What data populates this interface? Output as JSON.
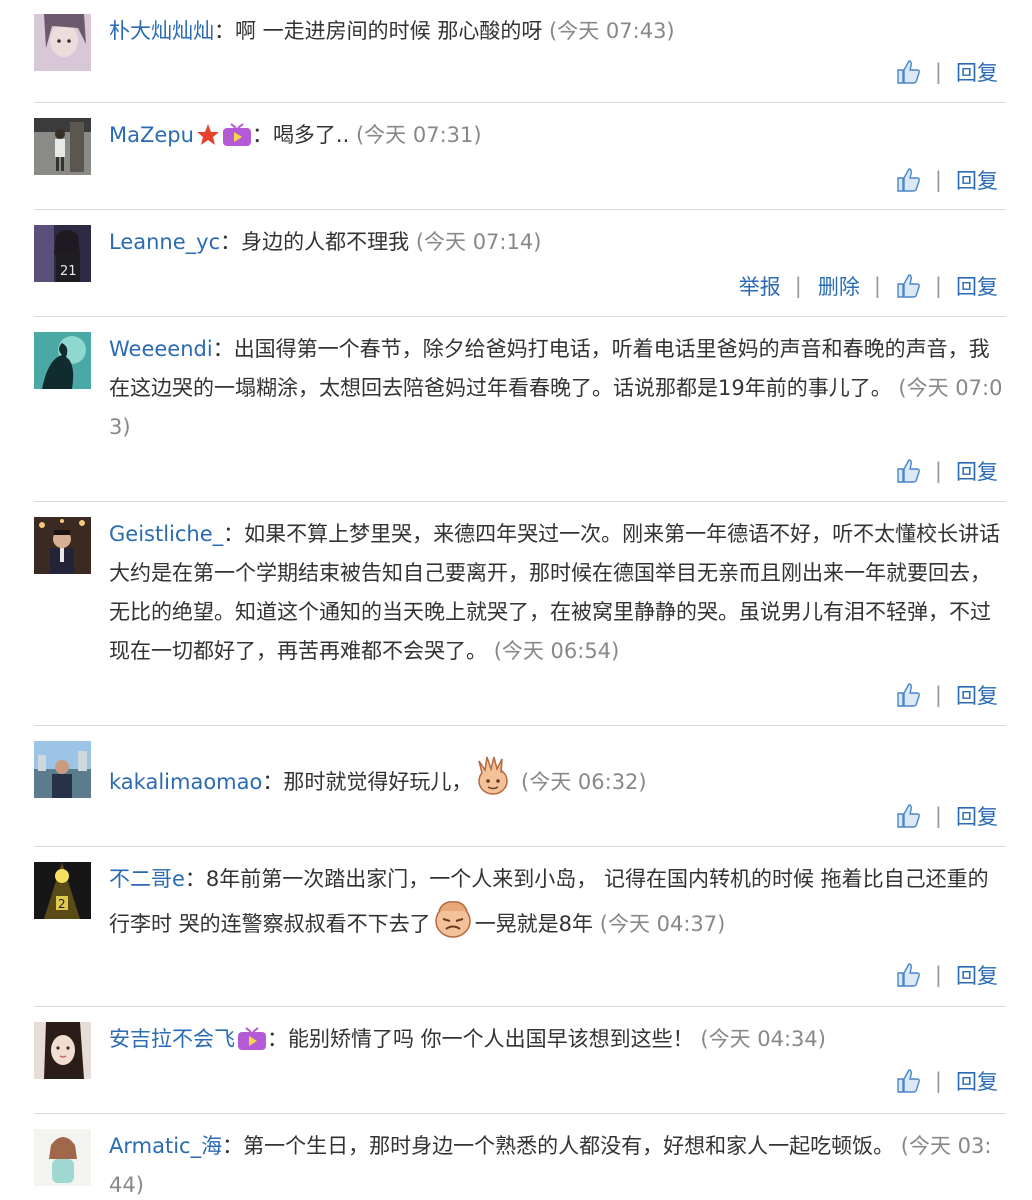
{
  "colors": {
    "name": "#2a6bb3",
    "time": "#888888",
    "text": "#333333",
    "divider": "#d9d9d9"
  },
  "labels": {
    "reply": "回复",
    "report": "举报",
    "delete": "删除",
    "separator": "|",
    "colon": "："
  },
  "comments": [
    {
      "name": "朴大灿灿灿",
      "text": "啊 一走进房间的时候 那心酸的呀",
      "time": "(今天 07:43)"
    },
    {
      "name": "MaZepu",
      "text": "喝多了..",
      "time": "(今天 07:31)"
    },
    {
      "name": "Leanne_yc",
      "text": "身边的人都不理我",
      "time": "(今天 07:14)"
    },
    {
      "name": "Weeeendi",
      "text": "出国得第一个春节，除夕给爸妈打电话，听着电话里爸妈的声音和春晚的声音，我在这边哭的一塌糊涂，太想回去陪爸妈过年看春晚了。话说那都是19年前的事儿了。",
      "time": "(今天 07:03)"
    },
    {
      "name": "Geistliche_",
      "text": "如果不算上梦里哭，来德四年哭过一次。刚来第一年德语不好，听不太懂校长讲话大约是在第一个学期结束被告知自己要离开，那时候在德国举目无亲而且刚出来一年就要回去，无比的绝望。知道这个通知的当天晚上就哭了，在被窝里静静的哭。虽说男儿有泪不轻弹，不过现在一切都好了，再苦再难都不会哭了。",
      "time": "(今天 06:54)"
    },
    {
      "name": "kakalimaomao",
      "text": "那时就觉得好玩儿，",
      "time": "(今天 06:32)"
    },
    {
      "name": "不二哥e",
      "text": "8年前第一次踏出家门，一个人来到小岛， 记得在国内转机的时候 拖着比自己还重的行李时 哭的连警察叔叔看不下去了",
      "text2": "一晃就是8年",
      "time": "(今天 04:37)"
    },
    {
      "name": "安吉拉不会飞",
      "text": "能别矫情了吗 你一个人出国早该想到这些！",
      "time": "(今天 04:34)"
    },
    {
      "name": "Armatic_海",
      "text": "第一个生日，那时身边一个熟悉的人都没有，好想和家人一起吃顿饭。",
      "time": "(今天 03:44)"
    }
  ]
}
